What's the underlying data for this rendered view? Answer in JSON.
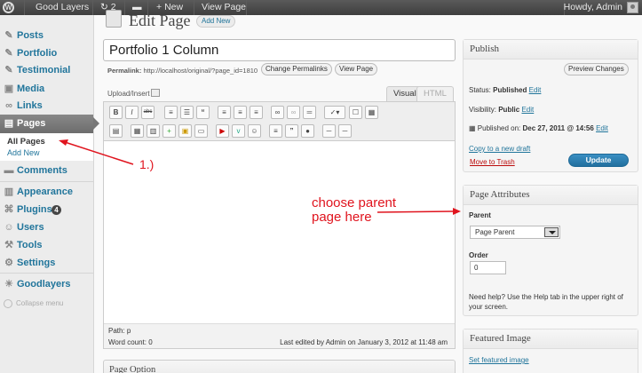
{
  "adminbar": {
    "site_name": "Good Layers",
    "updates_count": "2",
    "new_label": "New",
    "view_page": "View Page",
    "howdy": "Howdy, Admin"
  },
  "sidebar": {
    "items": [
      {
        "label": "Posts",
        "icon": "pin-icon"
      },
      {
        "label": "Portfolio",
        "icon": "pin-icon"
      },
      {
        "label": "Testimonial",
        "icon": "pin-icon"
      },
      {
        "label": "Media",
        "icon": "media-icon"
      },
      {
        "label": "Links",
        "icon": "link-icon"
      },
      {
        "label": "Pages",
        "icon": "pages-icon"
      },
      {
        "label": "Comments",
        "icon": "comments-icon"
      },
      {
        "label": "Appearance",
        "icon": "appearance-icon"
      },
      {
        "label": "Plugins",
        "icon": "plugins-icon",
        "badge": "4"
      },
      {
        "label": "Users",
        "icon": "users-icon"
      },
      {
        "label": "Tools",
        "icon": "tools-icon"
      },
      {
        "label": "Settings",
        "icon": "settings-icon"
      },
      {
        "label": "Goodlayers",
        "icon": "goodlayers-icon"
      }
    ],
    "pages_submenu": [
      "All Pages",
      "Add New"
    ],
    "collapse": "Collapse menu"
  },
  "main": {
    "title": "Edit Page",
    "add_new": "Add New",
    "post_title": "Portfolio 1 Column",
    "permalink_label": "Permalink:",
    "permalink_url": "http://localhost/original/?page_id=1810",
    "change_permalinks": "Change Permalinks",
    "view_page": "View Page",
    "upload_insert": "Upload/Insert",
    "tab_visual": "Visual",
    "tab_html": "HTML",
    "path": "Path: p",
    "word_count": "Word count: 0",
    "last_edited": "Last edited by Admin on January 3, 2012 at 11:48 am",
    "page_option": "Page Option"
  },
  "publish": {
    "title": "Publish",
    "preview": "Preview Changes",
    "status_label": "Status:",
    "status_value": "Published",
    "visibility_label": "Visibility:",
    "visibility_value": "Public",
    "published_on_label": "Published on:",
    "published_on_value": "Dec 27, 2011 @ 14:56",
    "edit": "Edit",
    "copy_draft": "Copy to a new draft",
    "trash": "Move to Trash",
    "update": "Update"
  },
  "page_attributes": {
    "title": "Page Attributes",
    "parent_label": "Parent",
    "parent_value": "Page Parent",
    "order_label": "Order",
    "order_value": "0",
    "help": "Need help? Use the Help tab in the upper right of your screen."
  },
  "featured_image": {
    "title": "Featured Image",
    "link": "Set featured image"
  },
  "annotations": {
    "step": "1.)",
    "note_line1": "choose parent",
    "note_line2": "page here",
    "color": "#e0141e"
  }
}
